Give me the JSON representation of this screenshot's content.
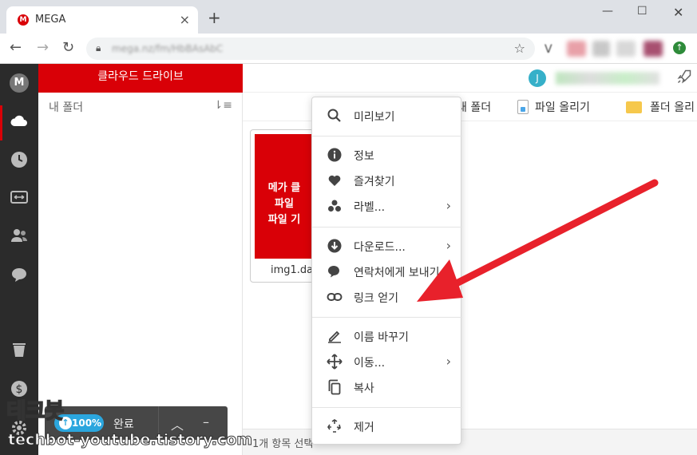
{
  "browser": {
    "tab_title": "MEGA",
    "favicon_letter": "M",
    "tab_close": "×",
    "new_tab": "+",
    "url": "mega.nz/fm/HbBAsAbC",
    "ext_v": "V"
  },
  "sidebar": {
    "logo": "M"
  },
  "tree": {
    "header": "클라우드 드라이브",
    "root_folder": "내 폴더"
  },
  "topbar": {
    "avatar_letter": "J"
  },
  "actions": {
    "new_folder": "새 폴더",
    "upload_file": "파일 올리기",
    "upload_folder": "폴더 올리"
  },
  "file": {
    "thumb_lines": [
      "메가 클",
      "파일",
      "파일 기"
    ],
    "name": "img1.dau"
  },
  "status": {
    "selected": "1개 항목 선택"
  },
  "transfer": {
    "percent": "100%",
    "label": "완료",
    "up_arrow": "↑",
    "expand": "︿",
    "minimize": "–"
  },
  "context_menu": {
    "items": [
      {
        "label": "미리보기",
        "icon": "search-icon"
      },
      {
        "label": "정보",
        "icon": "info-icon"
      },
      {
        "label": "즐겨찾기",
        "icon": "heart-icon"
      },
      {
        "label": "라벨...",
        "icon": "label-icon",
        "submenu": true
      },
      {
        "label": "다운로드...",
        "icon": "download-icon",
        "submenu": true
      },
      {
        "label": "연락처에게 보내기",
        "icon": "chat-icon"
      },
      {
        "label": "링크 얻기",
        "icon": "link-icon"
      },
      {
        "label": "이름 바꾸기",
        "icon": "pencil-icon"
      },
      {
        "label": "이동...",
        "icon": "move-icon",
        "submenu": true
      },
      {
        "label": "복사",
        "icon": "copy-icon"
      },
      {
        "label": "제거",
        "icon": "recycle-icon"
      }
    ]
  },
  "watermark": {
    "korean": "테크봇",
    "site": "techbot-youtube.tistory.com"
  },
  "colors": {
    "mega_red": "#d90007",
    "annotation_red": "#e8212b",
    "leftbar": "#2b2b2b",
    "transfer_blue": "#2ba6de"
  }
}
